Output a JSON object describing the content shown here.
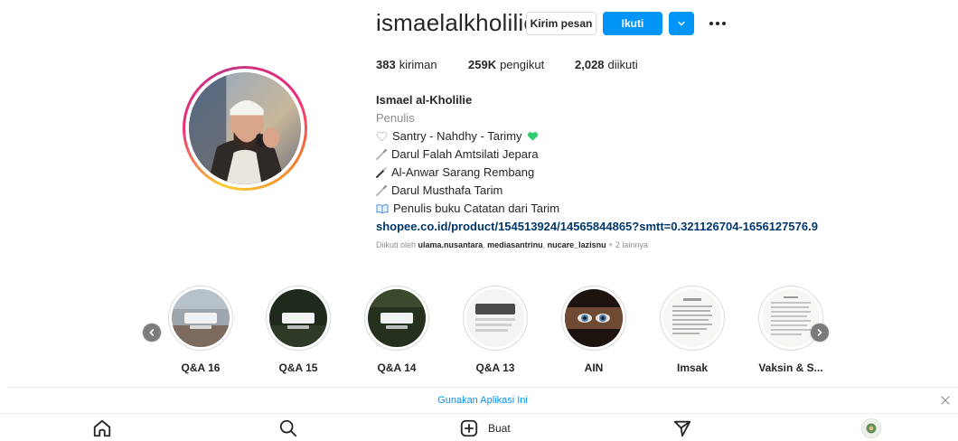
{
  "profile": {
    "username": "ismaelalkholilie",
    "message_button": "Kirim pesan",
    "follow_button": "Ikuti"
  },
  "stats": {
    "posts_count": "383",
    "posts_label": "kiriman",
    "followers_count": "259K",
    "followers_label": "pengikut",
    "following_count": "2,028",
    "following_label": "diikuti"
  },
  "bio": {
    "name": "Ismael al-Kholilie",
    "category": "Penulis",
    "lines": [
      "Santry - Nahdhy - Tarimy",
      "Darul Falah Amtsilati Jepara",
      "Al-Anwar Sarang Rembang",
      "Darul Musthafa Tarim",
      "Penulis buku Catatan dari Tarim"
    ],
    "link": "shopee.co.id/product/154513924/14565844865?smtt=0.321126704-1656127576.9",
    "followed_prefix": "Diikuti oleh",
    "followed_users": [
      "ulama.nusantara",
      "mediasantrinu",
      "nucare_lazisnu"
    ],
    "followed_suffix": "+ 2 lainnya"
  },
  "highlights": [
    {
      "label": "Q&A 16"
    },
    {
      "label": "Q&A 15"
    },
    {
      "label": "Q&A 14"
    },
    {
      "label": "Q&A 13"
    },
    {
      "label": "AIN"
    },
    {
      "label": "Imsak"
    },
    {
      "label": "Vaksin & S..."
    }
  ],
  "banner": {
    "text": "Gunakan Aplikasi Ini"
  },
  "nav": {
    "create_label": "Buat",
    "icons": [
      "home-icon",
      "search-icon",
      "create-icon",
      "explore-icon",
      "profile-avatar"
    ]
  },
  "colors": {
    "accent": "#0095f6",
    "link": "#00376b",
    "muted": "#8e8e8e",
    "heart": "#2ecc71"
  }
}
